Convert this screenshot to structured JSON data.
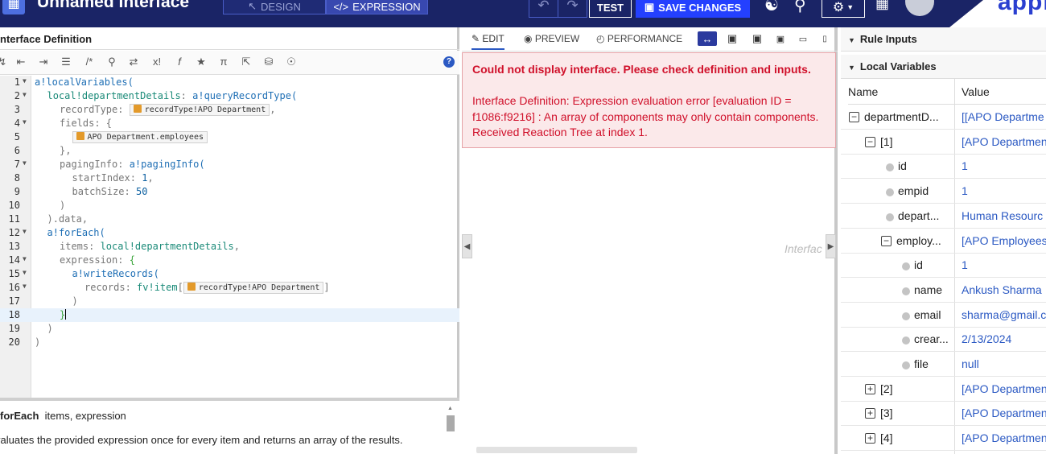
{
  "header": {
    "title": "Unnamed Interface",
    "design_label": "DESIGN",
    "expression_label": "EXPRESSION",
    "test_label": "TEST",
    "save_label": "SAVE CHANGES",
    "brand": "appia"
  },
  "left_panel": {
    "title": "nterface Definition",
    "toolbar_icons": [
      "wrap-icon",
      "outdent-icon",
      "indent-icon",
      "format-icon",
      "comment-icon",
      "search-icon",
      "shuffle-icon",
      "clear-icon",
      "function-icon",
      "star-icon",
      "pi-icon",
      "export-icon",
      "database-icon",
      "globe-icon"
    ],
    "code_lines": [
      {
        "n": "1",
        "fold": true
      },
      {
        "n": "2",
        "fold": true
      },
      {
        "n": "3",
        "fold": false
      },
      {
        "n": "4",
        "fold": true
      },
      {
        "n": "5",
        "fold": false
      },
      {
        "n": "6",
        "fold": false
      },
      {
        "n": "7",
        "fold": true
      },
      {
        "n": "8",
        "fold": false
      },
      {
        "n": "9",
        "fold": false
      },
      {
        "n": "10",
        "fold": false
      },
      {
        "n": "11",
        "fold": false
      },
      {
        "n": "12",
        "fold": true
      },
      {
        "n": "13",
        "fold": false
      },
      {
        "n": "14",
        "fold": true
      },
      {
        "n": "15",
        "fold": true
      },
      {
        "n": "16",
        "fold": true
      },
      {
        "n": "17",
        "fold": false
      },
      {
        "n": "18",
        "fold": false
      },
      {
        "n": "19",
        "fold": false
      },
      {
        "n": "20",
        "fold": false
      }
    ],
    "code": {
      "l1": "a!localVariables(",
      "l2a": "local!departmentDetails",
      "l2b": ": ",
      "l2c": "a!queryRecordType(",
      "l3a": "recordType: ",
      "l3chip": "recordType!APO Department",
      "l3b": ",",
      "l4": "fields: {",
      "l5chip": "APO Department.employees",
      "l6": "},",
      "l7a": "pagingInfo: ",
      "l7b": "a!pagingInfo(",
      "l8a": "startIndex: ",
      "l8b": "1",
      "l8c": ",",
      "l9a": "batchSize: ",
      "l9b": "50",
      "l10": ")",
      "l11": ").data,",
      "l12": "a!forEach(",
      "l13a": "items: ",
      "l13b": "local!departmentDetails",
      "l13c": ",",
      "l14a": "expression: ",
      "l14b": "{",
      "l15": "a!writeRecords(",
      "l16a": "records: ",
      "l16b": "fv!item",
      "l16c": "[",
      "l16chip": "recordType!APO Department",
      "l16d": "]",
      "l17": ")",
      "l18": "}",
      "l19": ")",
      "l20": ")"
    },
    "doc": {
      "func": "forEach",
      "params": "items, expression",
      "description": "valuates the provided expression once for every item and returns an array of the results."
    }
  },
  "middle_panel": {
    "tabs": {
      "edit": "EDIT",
      "preview": "PREVIEW",
      "performance": "PERFORMANCE"
    },
    "error": {
      "title": "Could not display interface. Please check definition and inputs.",
      "body": "Interface Definition: Expression evaluation error [evaluation ID = f1086:f9216] : An array of components may only contain components.  Received Reaction Tree at index 1."
    },
    "ghost_text": "Interfac"
  },
  "right_panel": {
    "rule_inputs": "Rule Inputs",
    "local_variables": "Local Variables",
    "col_name": "Name",
    "col_value": "Value",
    "rows": [
      {
        "name": "departmentD...",
        "value": "[[APO Departme",
        "kind": "minus",
        "indent": 0
      },
      {
        "name": "[1]",
        "value": "[APO Departmen",
        "kind": "minus",
        "indent": 1
      },
      {
        "name": "id",
        "value": "1",
        "kind": "dot",
        "indent": 2
      },
      {
        "name": "empid",
        "value": "1",
        "kind": "dot",
        "indent": 2
      },
      {
        "name": "depart...",
        "value": "Human Resourc",
        "kind": "dot",
        "indent": 2
      },
      {
        "name": "employ...",
        "value": "[APO Employees",
        "kind": "minus",
        "indent": 2
      },
      {
        "name": "id",
        "value": "1",
        "kind": "dot",
        "indent": 3
      },
      {
        "name": "name",
        "value": "Ankush Sharma",
        "kind": "dot",
        "indent": 3
      },
      {
        "name": "email",
        "value": "sharma@gmail.c",
        "kind": "dot",
        "indent": 3
      },
      {
        "name": "crear...",
        "value": "2/13/2024",
        "kind": "dot",
        "indent": 3
      },
      {
        "name": "file",
        "value": "null",
        "kind": "dot",
        "indent": 3
      },
      {
        "name": "[2]",
        "value": "[APO Departmen",
        "kind": "plus",
        "indent": 1
      },
      {
        "name": "[3]",
        "value": "[APO Departmen",
        "kind": "plus",
        "indent": 1
      },
      {
        "name": "[4]",
        "value": "[APO Departmen",
        "kind": "plus",
        "indent": 1
      }
    ]
  },
  "colors": {
    "topbar": "#1a2466",
    "accent": "#2b59c3",
    "save": "#2440ff",
    "error_text": "#d0102a",
    "error_bg": "#fbe9ea"
  }
}
